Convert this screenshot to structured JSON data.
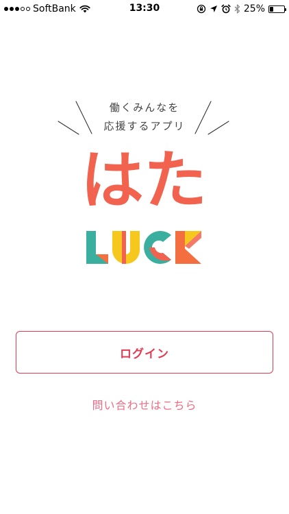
{
  "status_bar": {
    "carrier": "SoftBank",
    "time": "13:30",
    "battery_percent": "25%",
    "battery_level": 0.25,
    "signal_filled": 3,
    "signal_total": 5
  },
  "logo": {
    "tagline_line1": "働くみんなを",
    "tagline_line2": "応援するアプリ",
    "name_jp": "はた",
    "name_en": "LUCK",
    "colors": {
      "primary": "#f1634f",
      "teal": "#3aaf9f",
      "yellow": "#f6c71c",
      "orange": "#f36f3f"
    }
  },
  "actions": {
    "login_label": "ログイン",
    "contact_label": "問い合わせはこちら"
  },
  "colors": {
    "login": "#e23a52",
    "contact": "#ef6d84"
  }
}
